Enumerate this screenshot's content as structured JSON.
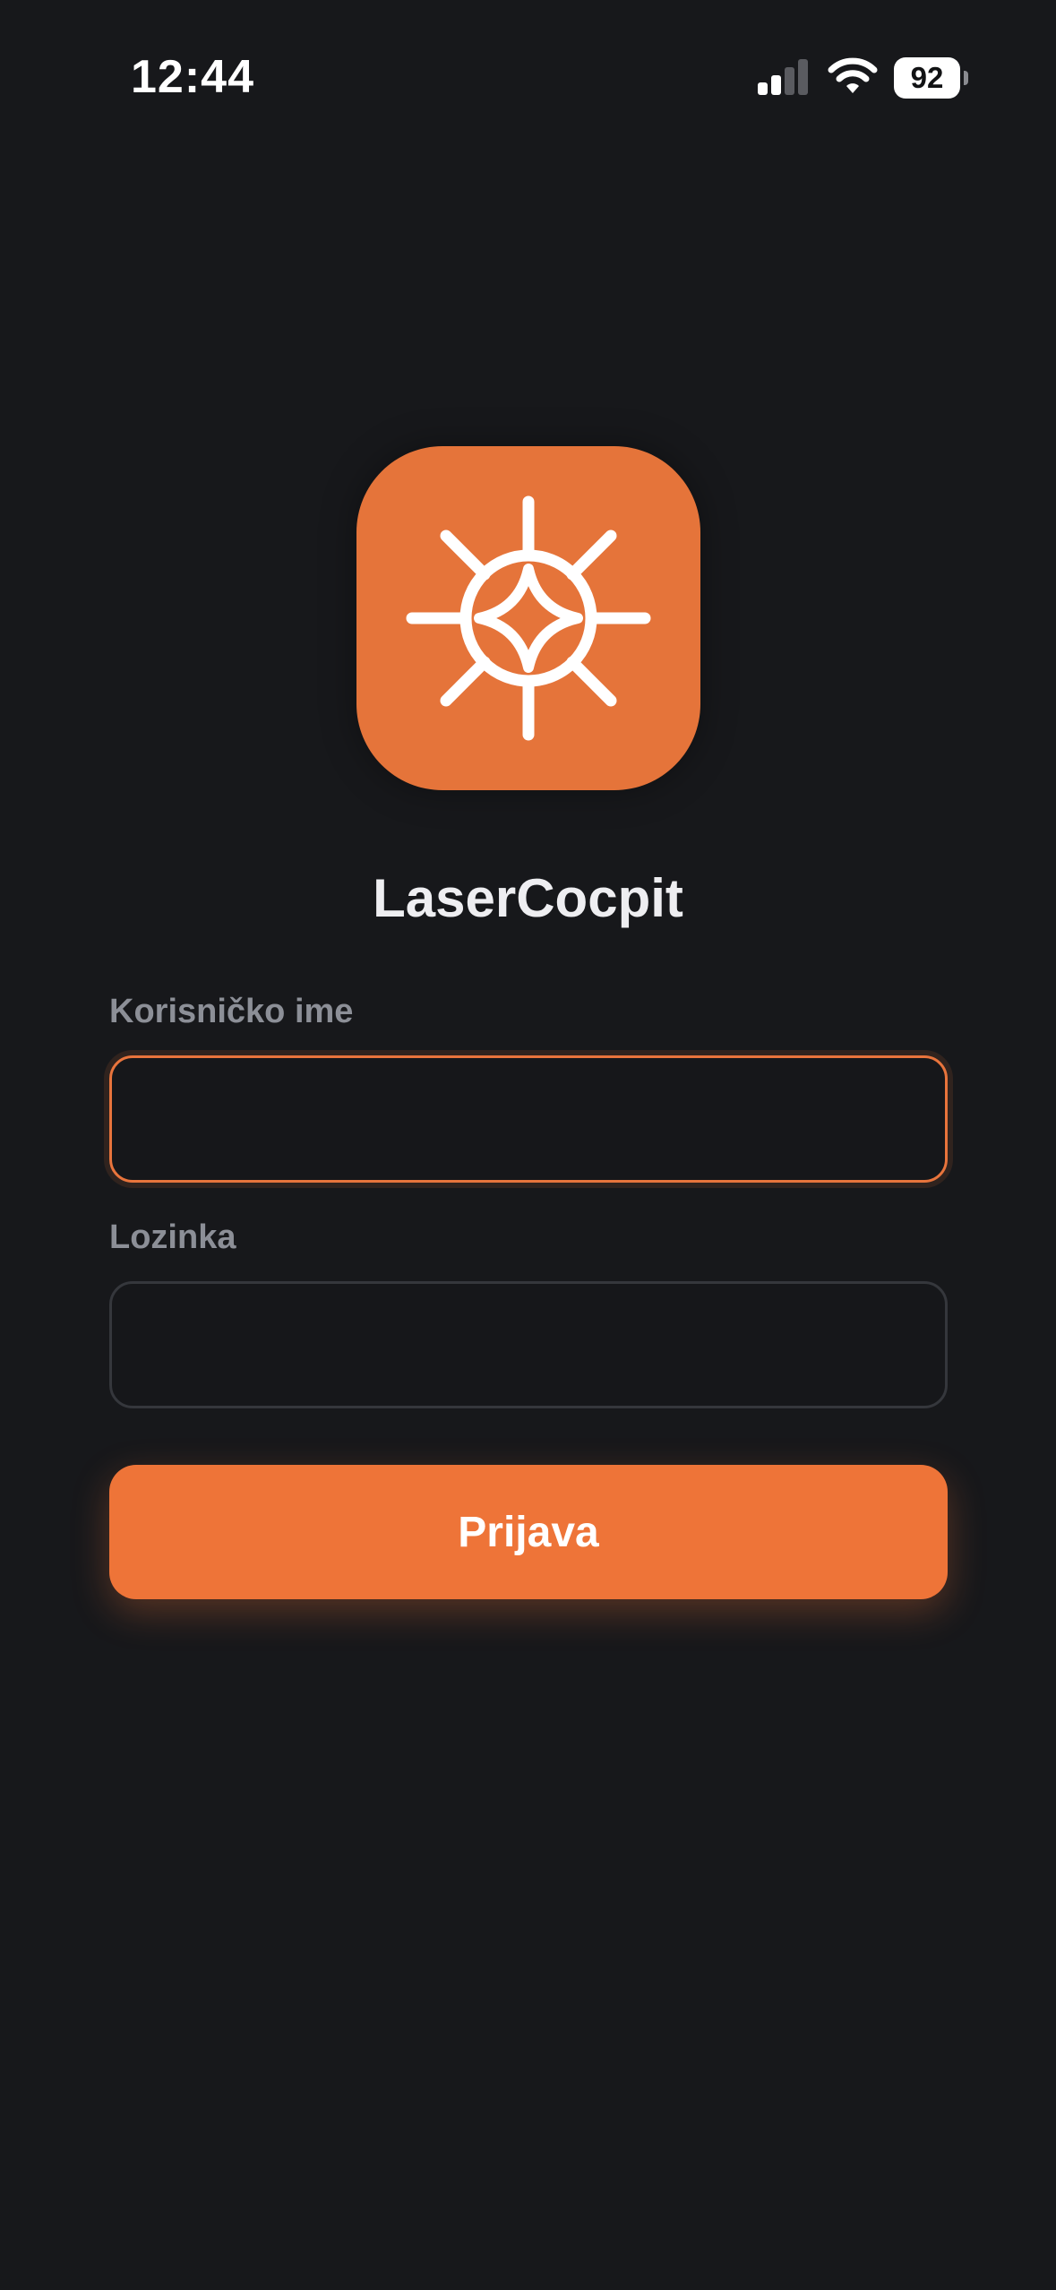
{
  "status_bar": {
    "time": "12:44",
    "battery_level": "92",
    "signal_icon": "cellular-signal-icon",
    "wifi_icon": "wifi-icon"
  },
  "app": {
    "logo_icon": "laser-cockpit-logo-icon",
    "title": "LaserCocpit"
  },
  "form": {
    "username": {
      "label": "Korisničko ime",
      "value": "",
      "placeholder": ""
    },
    "password": {
      "label": "Lozinka",
      "value": "",
      "placeholder": ""
    },
    "submit_label": "Prijava"
  },
  "colors": {
    "background": "#17181b",
    "accent": "#ee7438",
    "logo_background": "#e5743a",
    "label": "#8c8f97",
    "input_border": "#35373c"
  }
}
